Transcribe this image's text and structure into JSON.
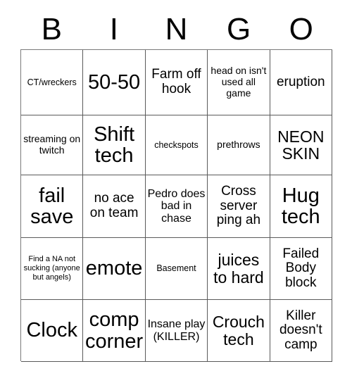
{
  "card": {
    "header_letters": [
      "B",
      "I",
      "N",
      "G",
      "O"
    ],
    "rows": [
      [
        {
          "text": "CT/wreckers",
          "size": "xs"
        },
        {
          "text": "50-50",
          "size": "xxl"
        },
        {
          "text": "Farm off hook",
          "size": "l"
        },
        {
          "text": "head on isn't used all game",
          "size": "s"
        },
        {
          "text": "eruption",
          "size": "l"
        }
      ],
      [
        {
          "text": "streaming on twitch",
          "size": "s"
        },
        {
          "text": "Shift tech",
          "size": "xxl"
        },
        {
          "text": "checkspots",
          "size": "xs"
        },
        {
          "text": "prethrows",
          "size": "s"
        },
        {
          "text": "NEON SKIN",
          "size": "xl"
        }
      ],
      [
        {
          "text": "fail save",
          "size": "xxl"
        },
        {
          "text": "no ace on team",
          "size": "l"
        },
        {
          "text": "Pedro does bad in chase",
          "size": "m"
        },
        {
          "text": "Cross server ping ah",
          "size": "l"
        },
        {
          "text": "Hug tech",
          "size": "xxl"
        }
      ],
      [
        {
          "text": "Find a NA not sucking (anyone but angels)",
          "size": "xxs"
        },
        {
          "text": "emote",
          "size": "xxl"
        },
        {
          "text": "Basement",
          "size": "xs"
        },
        {
          "text": "juices to hard",
          "size": "xl"
        },
        {
          "text": "Failed Body block",
          "size": "l"
        }
      ],
      [
        {
          "text": "Clock",
          "size": "xxl"
        },
        {
          "text": "comp corner",
          "size": "xxl"
        },
        {
          "text": "Insane play (KILLER)",
          "size": "m"
        },
        {
          "text": "Crouch tech",
          "size": "xl"
        },
        {
          "text": "Killer doesn't camp",
          "size": "l"
        }
      ]
    ]
  },
  "colors": {
    "background": "#ffffff",
    "text": "#000000",
    "grid_line": "#5a5a5a"
  }
}
